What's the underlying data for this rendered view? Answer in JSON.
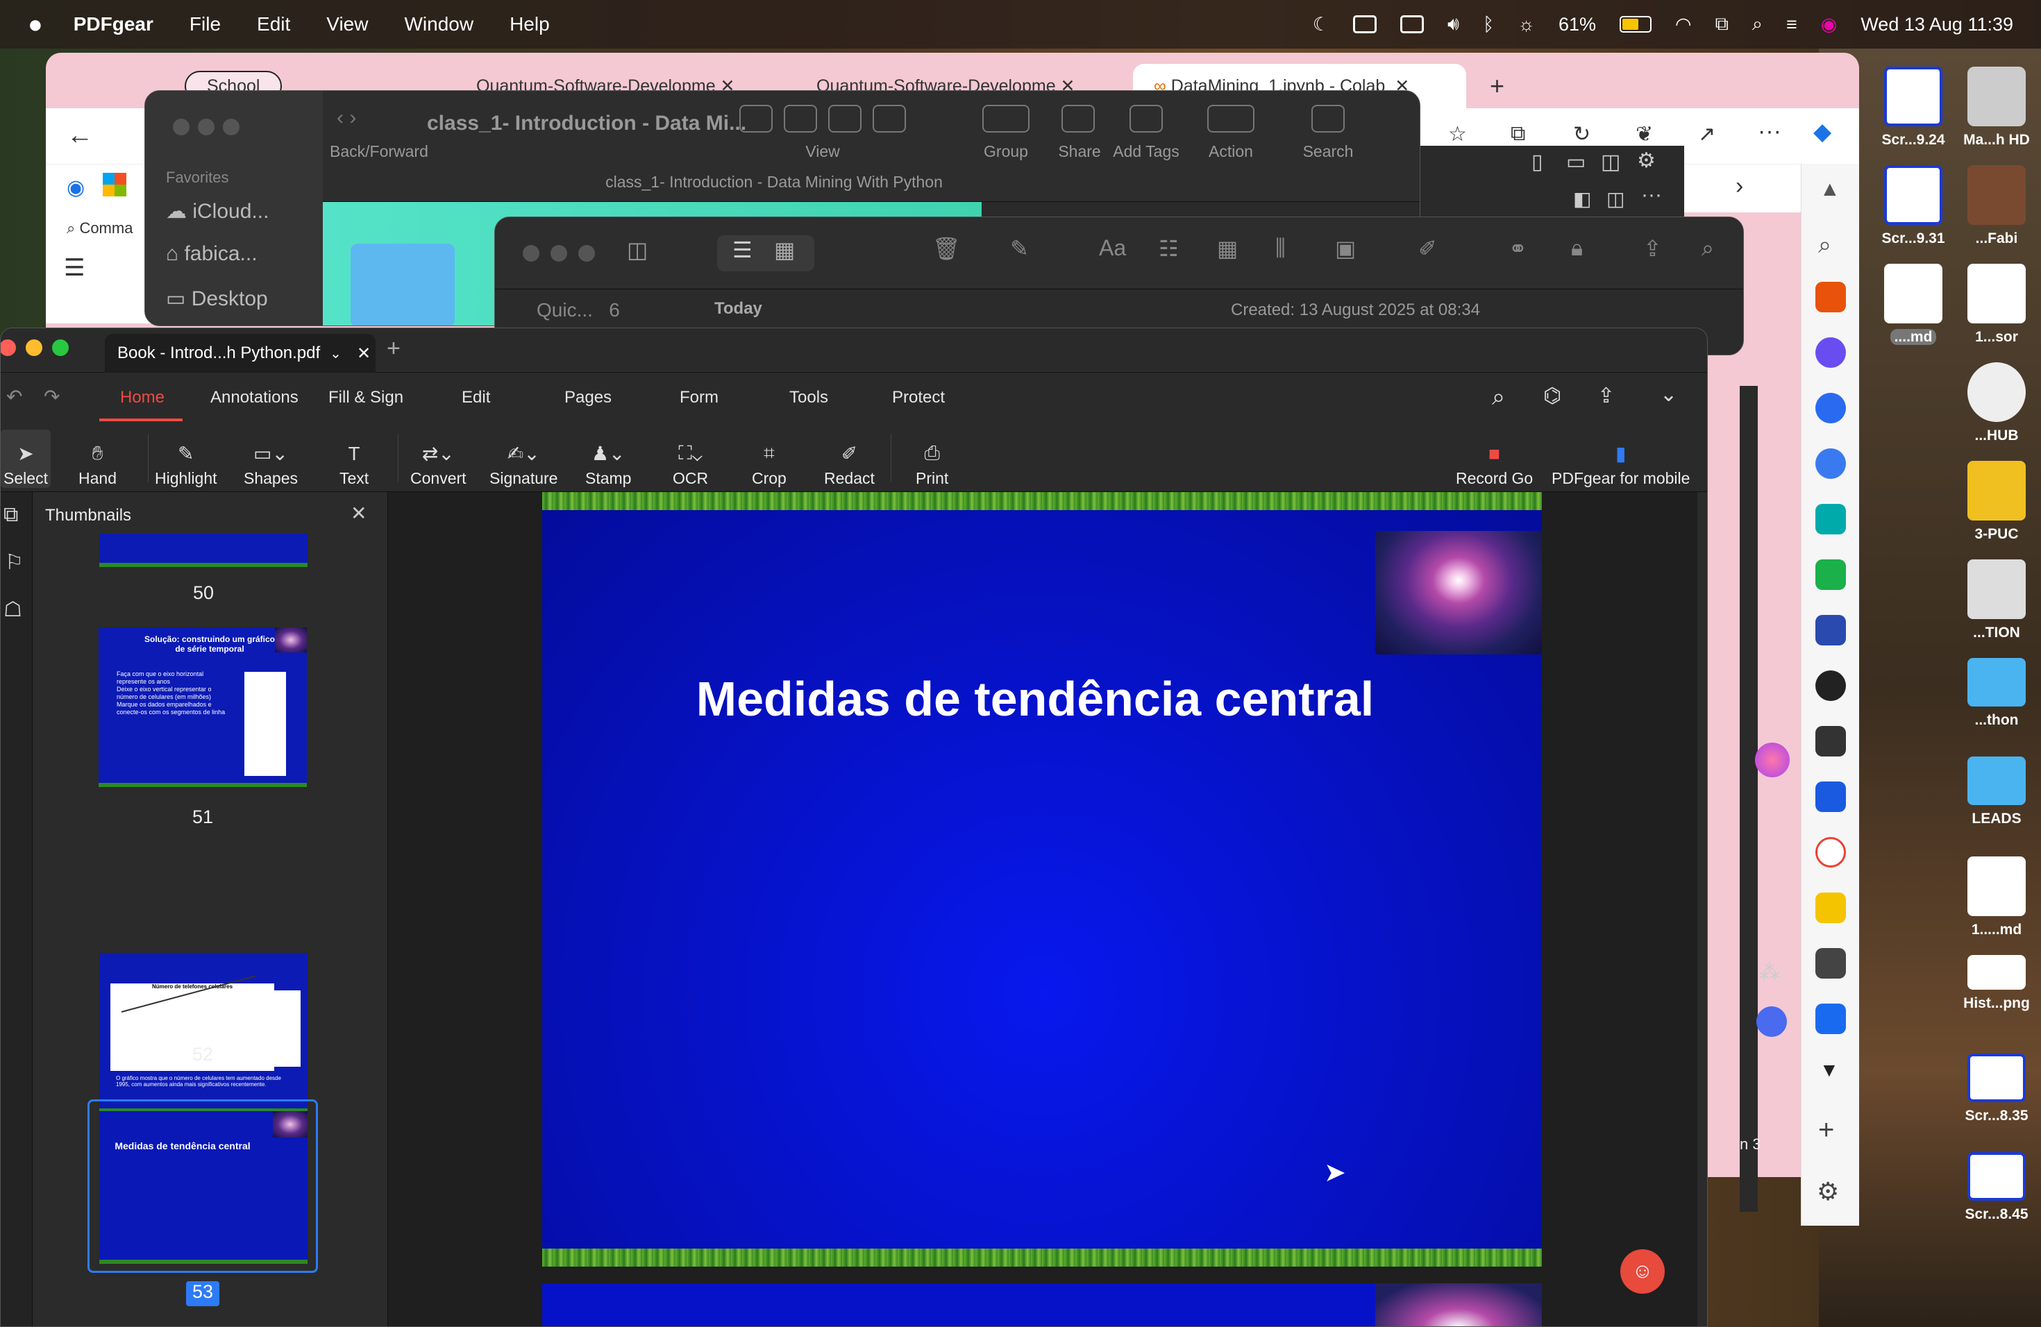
{
  "menubar": {
    "app": "PDFgear",
    "items": [
      "File",
      "Edit",
      "View",
      "Window",
      "Help"
    ],
    "battery": "61%",
    "battery_level": 0.61,
    "datetime": "Wed 13 Aug  11:39"
  },
  "browser": {
    "tabs": [
      "School",
      "Quantum-Software-Developme",
      "Quantum-Software-Developme",
      "DataMining_1.ipynb - Colab"
    ],
    "sidebar_text": "Comma",
    "page_fragment": "n 3"
  },
  "finder": {
    "title": "class_1- Introduction - Data Mi...",
    "path": "class_1- Introduction - Data Mining With Python",
    "back_forward": "Back/Forward",
    "view": "View",
    "group": "Group",
    "share": "Share",
    "add_tags": "Add Tags",
    "action": "Action",
    "search": "Search",
    "favorites": "Favorites",
    "sidebar": [
      "iCloud...",
      "fabica...",
      "Desktop"
    ]
  },
  "notes": {
    "folder": "Quic...",
    "count": "6",
    "today": "Today",
    "created": "Created: 13 August 2025 at 08:34"
  },
  "pdf": {
    "tab_title": "Book - Introd...h Python.pdf",
    "menu_tabs": [
      "Home",
      "Annotations",
      "Fill & Sign",
      "Edit",
      "Pages",
      "Form",
      "Tools",
      "Protect"
    ],
    "tools": [
      "Select",
      "Hand",
      "Highlight",
      "Shapes",
      "Text",
      "Convert",
      "Signature",
      "Stamp",
      "OCR",
      "Crop",
      "Redact",
      "Print"
    ],
    "record": "Record Go",
    "mobile": "PDFgear for mobile",
    "thumbnails_label": "Thumbnails",
    "thumbs": [
      {
        "num": "50"
      },
      {
        "num": "51",
        "title": "Solução: construindo um gráfico de série temporal",
        "bullets": [
          "Faça com que o eixo horizontal represente os anos",
          "Deixe o eixo vertical representar o número de celulares (em milhões)",
          "Marque os dados emparelhados e conecte-os com os segmentos de linha"
        ]
      },
      {
        "num": "52",
        "title": "Número de telefones celulares",
        "caption": "O gráfico mostra que o número de celulares tem aumentado desde 1995, com aumentos ainda mais significativos recentemente."
      },
      {
        "num": "53",
        "title": "Medidas de tendência central"
      }
    ],
    "slide_title": "Medidas de tendência central"
  },
  "desktop": [
    "Scr...9.24",
    "Ma...h HD",
    "Scr...9.31",
    "...Fabi",
    "....md",
    "1...sor",
    "...HUB",
    "3-PUC",
    "...TION",
    "...thon",
    "LEADS",
    "1.....md",
    "Hist...png",
    "Scr...8.35",
    "Scr...8.45"
  ],
  "colors": {
    "accent": "#f04a44",
    "slide_bg": "#0612c8",
    "selected": "#2e7bf6"
  }
}
